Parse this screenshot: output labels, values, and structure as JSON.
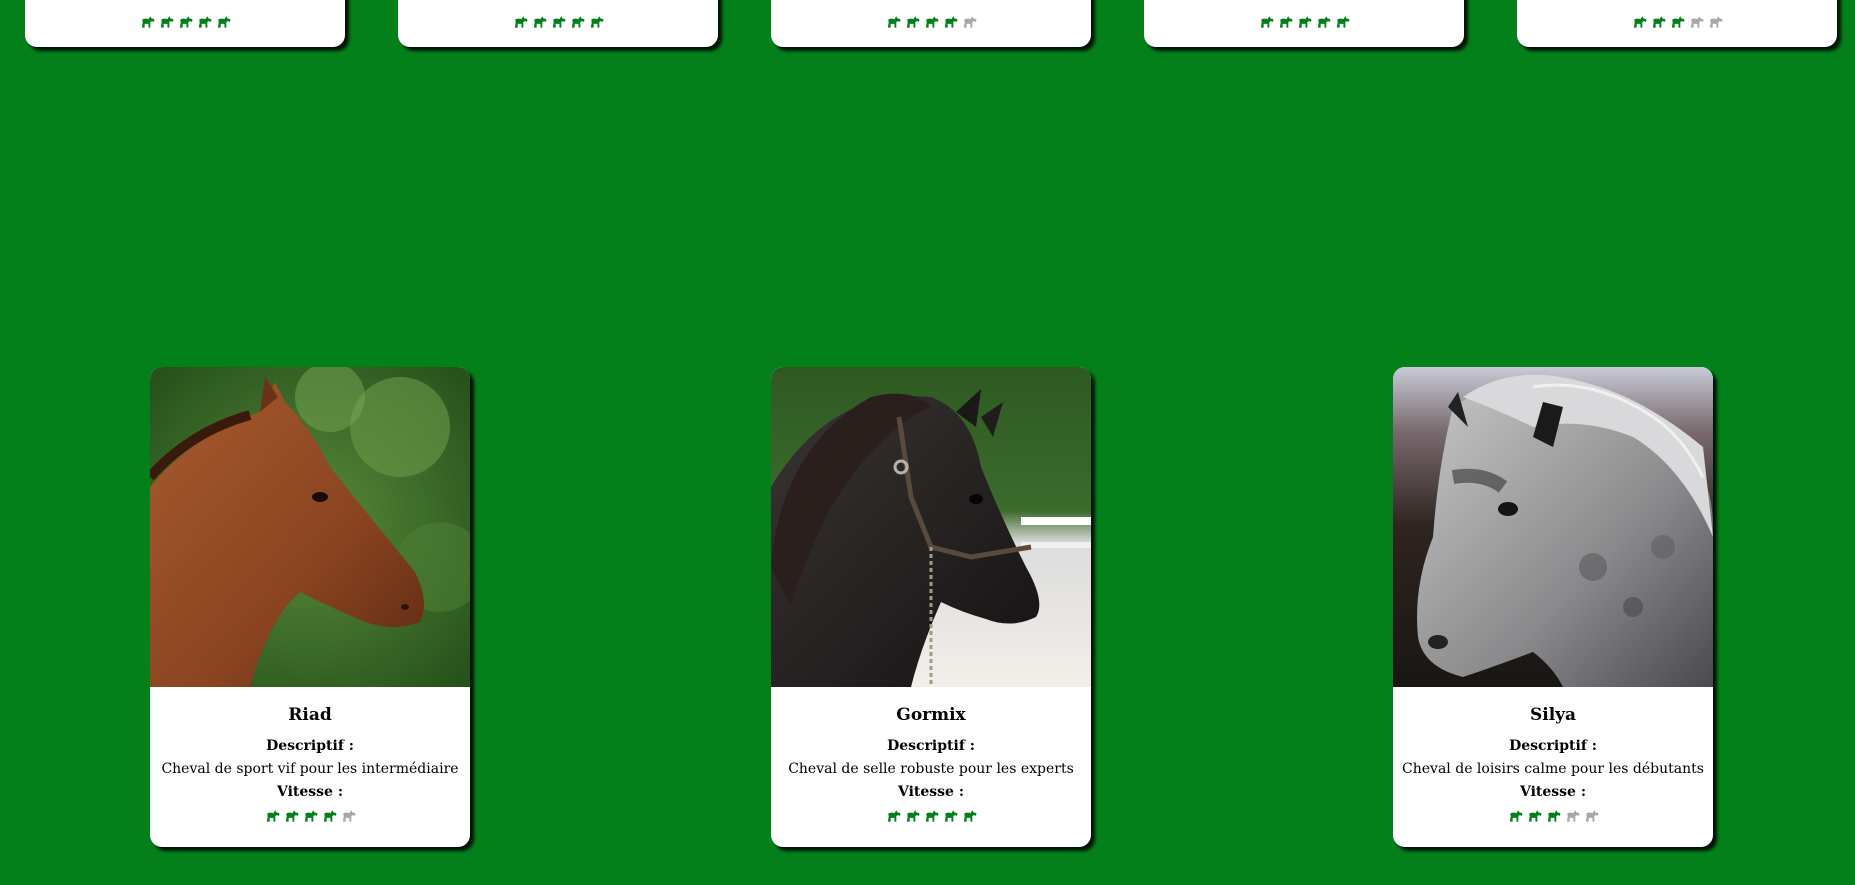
{
  "colors": {
    "background": "#04801b",
    "rating_on": "#04801b",
    "rating_off": "#a8a8a8",
    "card": "#ffffff"
  },
  "top_cards": [
    {
      "speed": 5
    },
    {
      "speed": 5
    },
    {
      "speed": 4
    },
    {
      "speed": 5
    },
    {
      "speed": 3
    }
  ],
  "cards": [
    {
      "name": "Riad",
      "desc_label": "Descriptif :",
      "description": "Cheval de sport vif pour les intermédiaire",
      "speed_label": "Vitesse :",
      "speed": 4,
      "max_speed": 5,
      "photo": "bay-horse-profile"
    },
    {
      "name": "Gormix",
      "desc_label": "Descriptif :",
      "description": "Cheval de selle robuste pour les experts",
      "speed_label": "Vitesse :",
      "speed": 5,
      "max_speed": 5,
      "photo": "black-horse-halter"
    },
    {
      "name": "Silya",
      "desc_label": "Descriptif :",
      "description": "Cheval de loisirs calme pour les débutants",
      "speed_label": "Vitesse :",
      "speed": 3,
      "max_speed": 5,
      "photo": "grey-dappled-horse"
    }
  ]
}
